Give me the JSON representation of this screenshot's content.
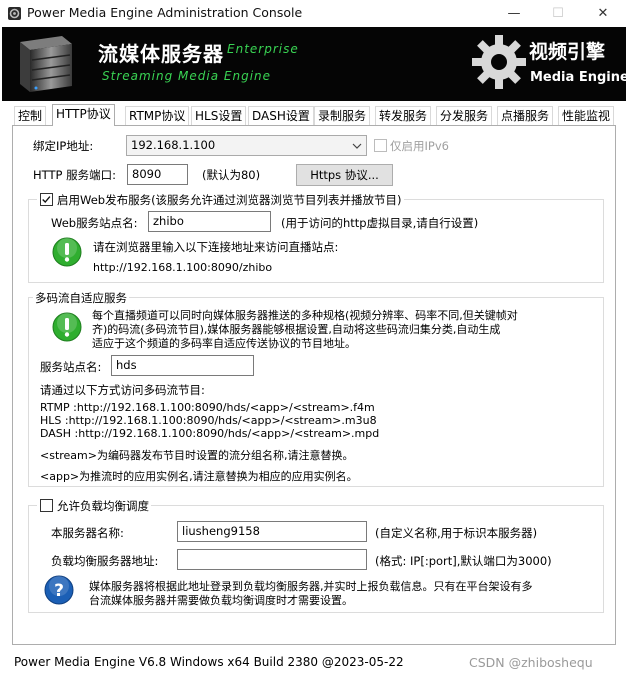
{
  "window": {
    "title": "Power Media Engine Administration Console",
    "minimize_glyph": "—",
    "maximize_glyph": "☐",
    "close_glyph": "✕"
  },
  "banner": {
    "cn_title": "流媒体服务器",
    "edition": "Enterprise",
    "en_subtitle": "Streaming Media Engine",
    "right_cn": "视频引擎",
    "right_en": "Media Engine",
    "icons": [
      "server-icon",
      "gear-icon"
    ]
  },
  "tabs": [
    {
      "label": "控制",
      "active": false
    },
    {
      "label": "HTTP协议",
      "active": true
    },
    {
      "label": "RTMP协议",
      "active": false
    },
    {
      "label": "HLS设置",
      "active": false
    },
    {
      "label": "DASH设置",
      "active": false
    },
    {
      "label": "录制服务",
      "active": false
    },
    {
      "label": "转发服务",
      "active": false
    },
    {
      "label": "分发服务",
      "active": false
    },
    {
      "label": "点播服务",
      "active": false
    },
    {
      "label": "性能监视",
      "active": false
    }
  ],
  "http": {
    "bind_ip_label": "绑定IP地址:",
    "bind_ip_value": "192.168.1.100",
    "ipv6_only_label": "仅启用IPv6",
    "port_label": "HTTP 服务端口:",
    "port_value": "8090",
    "port_default_hint": "(默认为80)",
    "https_button": "Https 协议..."
  },
  "web_publish": {
    "enable_label": "启用Web发布服务(该服务允许通过浏览器浏览节目列表并播放节目)",
    "enabled": true,
    "site_name_label": "Web服务站点名:",
    "site_name_value": "zhibo",
    "site_name_hint": "(用于访问的http虚拟目录,请自行设置)",
    "info_text": "请在浏览器里输入以下连接地址来访问直播站点:",
    "url": "http://192.168.1.100:8090/zhibo"
  },
  "adaptive": {
    "group_title": "多码流自适应服务",
    "info_lines": [
      "每个直播频道可以同时向媒体服务器推送的多种规格(视频分辨率、码率不同,但关键帧对",
      "齐)的码流(多码流节目),媒体服务器能够根据设置,自动将这些码流归集分类,自动生成",
      "适应于这个频道的多码率自适应传送协议的节目地址。"
    ],
    "site_name_label": "服务站点名:",
    "site_name_value": "hds",
    "access_intro": "请通过以下方式访问多码流节目:",
    "urls": [
      "RTMP :http://192.168.1.100:8090/hds/<app>/<stream>.f4m",
      "HLS :http://192.168.1.100:8090/hds/<app>/<stream>.m3u8",
      "DASH :http://192.168.1.100:8090/hds/<app>/<stream>.mpd"
    ],
    "notes": [
      "<stream>为编码器发布节目时设置的流分组名称,请注意替换。",
      "<app>为推流时的应用实例名,请注意替换为相应的应用实例名。"
    ]
  },
  "load_balance": {
    "enable_label": "允许负载均衡调度",
    "enabled": false,
    "server_name_label": "本服务器名称:",
    "server_name_value": "liusheng9158",
    "server_name_hint": "(自定义名称,用于标识本服务器)",
    "lb_address_label": "负载均衡服务器地址:",
    "lb_address_value": "",
    "lb_address_hint": "(格式: IP[:port],默认端口为3000)",
    "info_lines": [
      "媒体服务器将根据此地址登录到负载均衡服务器,并实时上报负载信息。只有在平台架设有多",
      "台流媒体服务器并需要做负载均衡调度时才需要设置。"
    ]
  },
  "footer": {
    "version": "Power Media Engine V6.8 Windows x64 Build 2380 @2023-05-22",
    "watermark": "CSDN @zhiboshequ"
  },
  "colors": {
    "banner_bg": "#050505",
    "banner_green": "#39d353",
    "info_green": "#2fae2f",
    "help_blue": "#1b5fb5"
  }
}
